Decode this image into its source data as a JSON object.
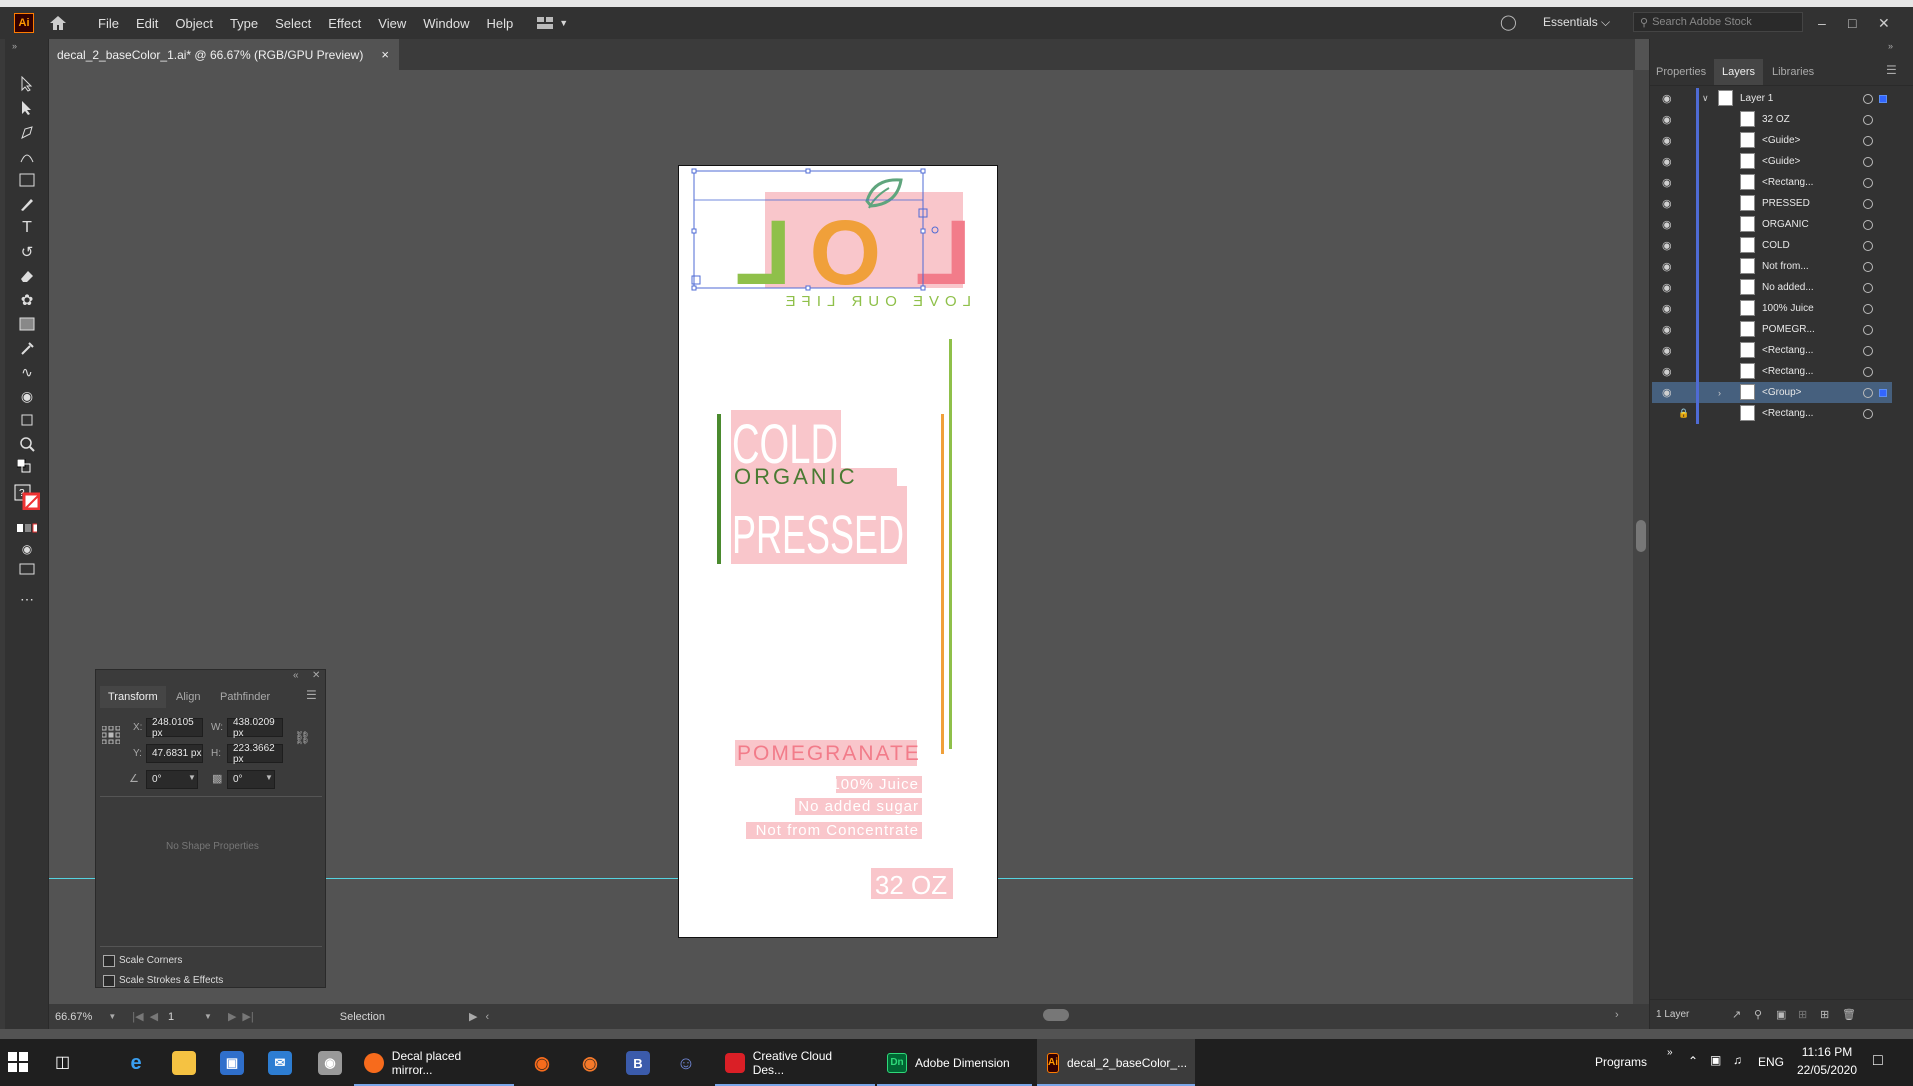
{
  "menubar": {
    "app_logo": "Ai",
    "menus": [
      "File",
      "Edit",
      "Object",
      "Type",
      "Select",
      "Effect",
      "View",
      "Window",
      "Help"
    ],
    "workspace": "Essentials",
    "search_placeholder": "Search Adobe Stock"
  },
  "document_tab": {
    "title": "decal_2_baseColor_1.ai* @ 66.67% (RGB/GPU Preview)",
    "close": "×"
  },
  "artwork": {
    "logo_text": "LOL",
    "tagline_mirrored": "LOVE OUR LIFE",
    "cold": "COLD",
    "organic": "ORGANIC",
    "pressed": "PRESSED",
    "flavor": "POMEGRANATE",
    "line1": "100% Juice",
    "line2": "No added sugar",
    "line3": "Not from Concentrate",
    "size": "32 OZ"
  },
  "right_panel": {
    "tabs": [
      "Properties",
      "Layers",
      "Libraries"
    ],
    "active_tab": "Layers",
    "layers": [
      {
        "name": "Layer 1",
        "level": 0,
        "expanded": true
      },
      {
        "name": "32 OZ",
        "level": 1
      },
      {
        "name": "<Guide>",
        "level": 1
      },
      {
        "name": "<Guide>",
        "level": 1
      },
      {
        "name": "<Rectang...",
        "level": 1
      },
      {
        "name": "PRESSED",
        "level": 1
      },
      {
        "name": "ORGANIC",
        "level": 1
      },
      {
        "name": "COLD",
        "level": 1
      },
      {
        "name": "Not from...",
        "level": 1
      },
      {
        "name": "No added...",
        "level": 1
      },
      {
        "name": "100% Juice",
        "level": 1
      },
      {
        "name": "POMEGR...",
        "level": 1
      },
      {
        "name": "<Rectang...",
        "level": 1
      },
      {
        "name": "<Rectang...",
        "level": 1
      },
      {
        "name": "<Group>",
        "level": 1,
        "selected": true
      },
      {
        "name": "<Rectang...",
        "level": 1,
        "locked": true
      }
    ],
    "footer": "1 Layer"
  },
  "transform_panel": {
    "tabs": [
      "Transform",
      "Align",
      "Pathfinder"
    ],
    "x_label": "X:",
    "x": "248.0105 px",
    "y_label": "Y:",
    "y": "47.6831 px",
    "w_label": "W:",
    "w": "438.0209 px",
    "h_label": "H:",
    "h": "223.3662 px",
    "rotate": "0°",
    "shear": "0°",
    "no_shape": "No Shape Properties",
    "scale_corners": "Scale Corners",
    "scale_strokes": "Scale Strokes & Effects"
  },
  "statusbar": {
    "zoom": "66.67%",
    "artboard": "1",
    "tool": "Selection"
  },
  "taskbar": {
    "apps": [
      {
        "label": "Decal placed mirror..."
      },
      {
        "label": "Creative Cloud Des..."
      },
      {
        "label": "Adobe Dimension"
      },
      {
        "label": "decal_2_baseColor_...",
        "active": true
      }
    ],
    "programs": "Programs",
    "lang": "ENG",
    "time": "11:16 PM",
    "date": "22/05/2020"
  },
  "colors": {
    "pink": "#f9c6cb",
    "green": "#6aa43a",
    "orange": "#f0a03a",
    "accent_blue": "#4f6bd4"
  }
}
